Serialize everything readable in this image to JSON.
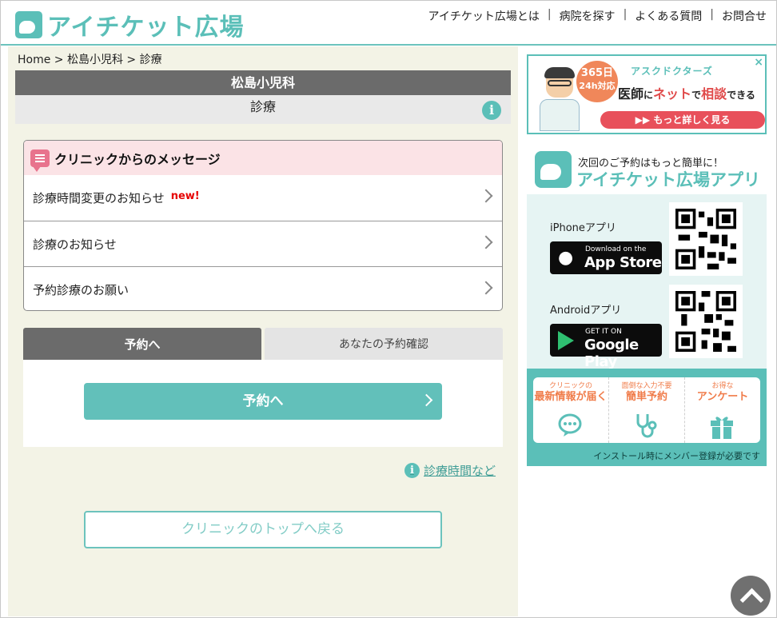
{
  "header": {
    "logo_text": "アイチケット広場",
    "nav": [
      "アイチケット広場とは",
      "病院を探す",
      "よくある質問",
      "お問合せ"
    ]
  },
  "breadcrumb": "Home > 松島小児科 > 診療",
  "clinic": {
    "name": "松島小児科",
    "section": "診療"
  },
  "messages": {
    "title": "クリニックからのメッセージ",
    "items": [
      {
        "label": "診療時間変更のお知らせ",
        "badge": "new!"
      },
      {
        "label": "診療のお知らせ",
        "badge": ""
      },
      {
        "label": "予約診療のお願い",
        "badge": ""
      }
    ]
  },
  "tabs": {
    "active": "予約へ",
    "other": "あなたの予約確認"
  },
  "reserve_button": "予約へ",
  "hours_link": "診療時間など",
  "back_button": "クリニックのトップへ戻る",
  "ad": {
    "close": "×",
    "badge_line1": "365日",
    "badge_line2": "24h対応",
    "brand": "アスクドクターズ",
    "tagline_a": "医師",
    "tagline_b": "に",
    "tagline_c": "ネット",
    "tagline_d": "で",
    "tagline_e": "相談",
    "tagline_f": "できる",
    "cta": "もっと詳しく見る"
  },
  "app_promo": {
    "subtitle": "次回のご予約はもっと簡単に！",
    "name": "アイチケット広場アプリ",
    "iphone_label": "iPhoneアプリ",
    "appstore_small": "Download on the",
    "appstore_big": "App Store",
    "android_label": "Androidアプリ",
    "gplay_small": "GET IT ON",
    "gplay_big": "Google Play",
    "features": [
      {
        "small": "クリニックの",
        "big": "最新情報が届く",
        "icon": "chat-icon"
      },
      {
        "small": "面倒な入力不要",
        "big": "簡単予約",
        "icon": "stethoscope-icon"
      },
      {
        "small": "お得な",
        "big": "アンケート",
        "icon": "gift-icon"
      }
    ],
    "note": "インストール時にメンバー登録が必要です"
  },
  "colors": {
    "accent": "#5bbfb8",
    "dark_bar": "#6b6b6b",
    "bg": "#f3f3e6",
    "pink": "#fbe3e6",
    "new": "#e60000"
  }
}
